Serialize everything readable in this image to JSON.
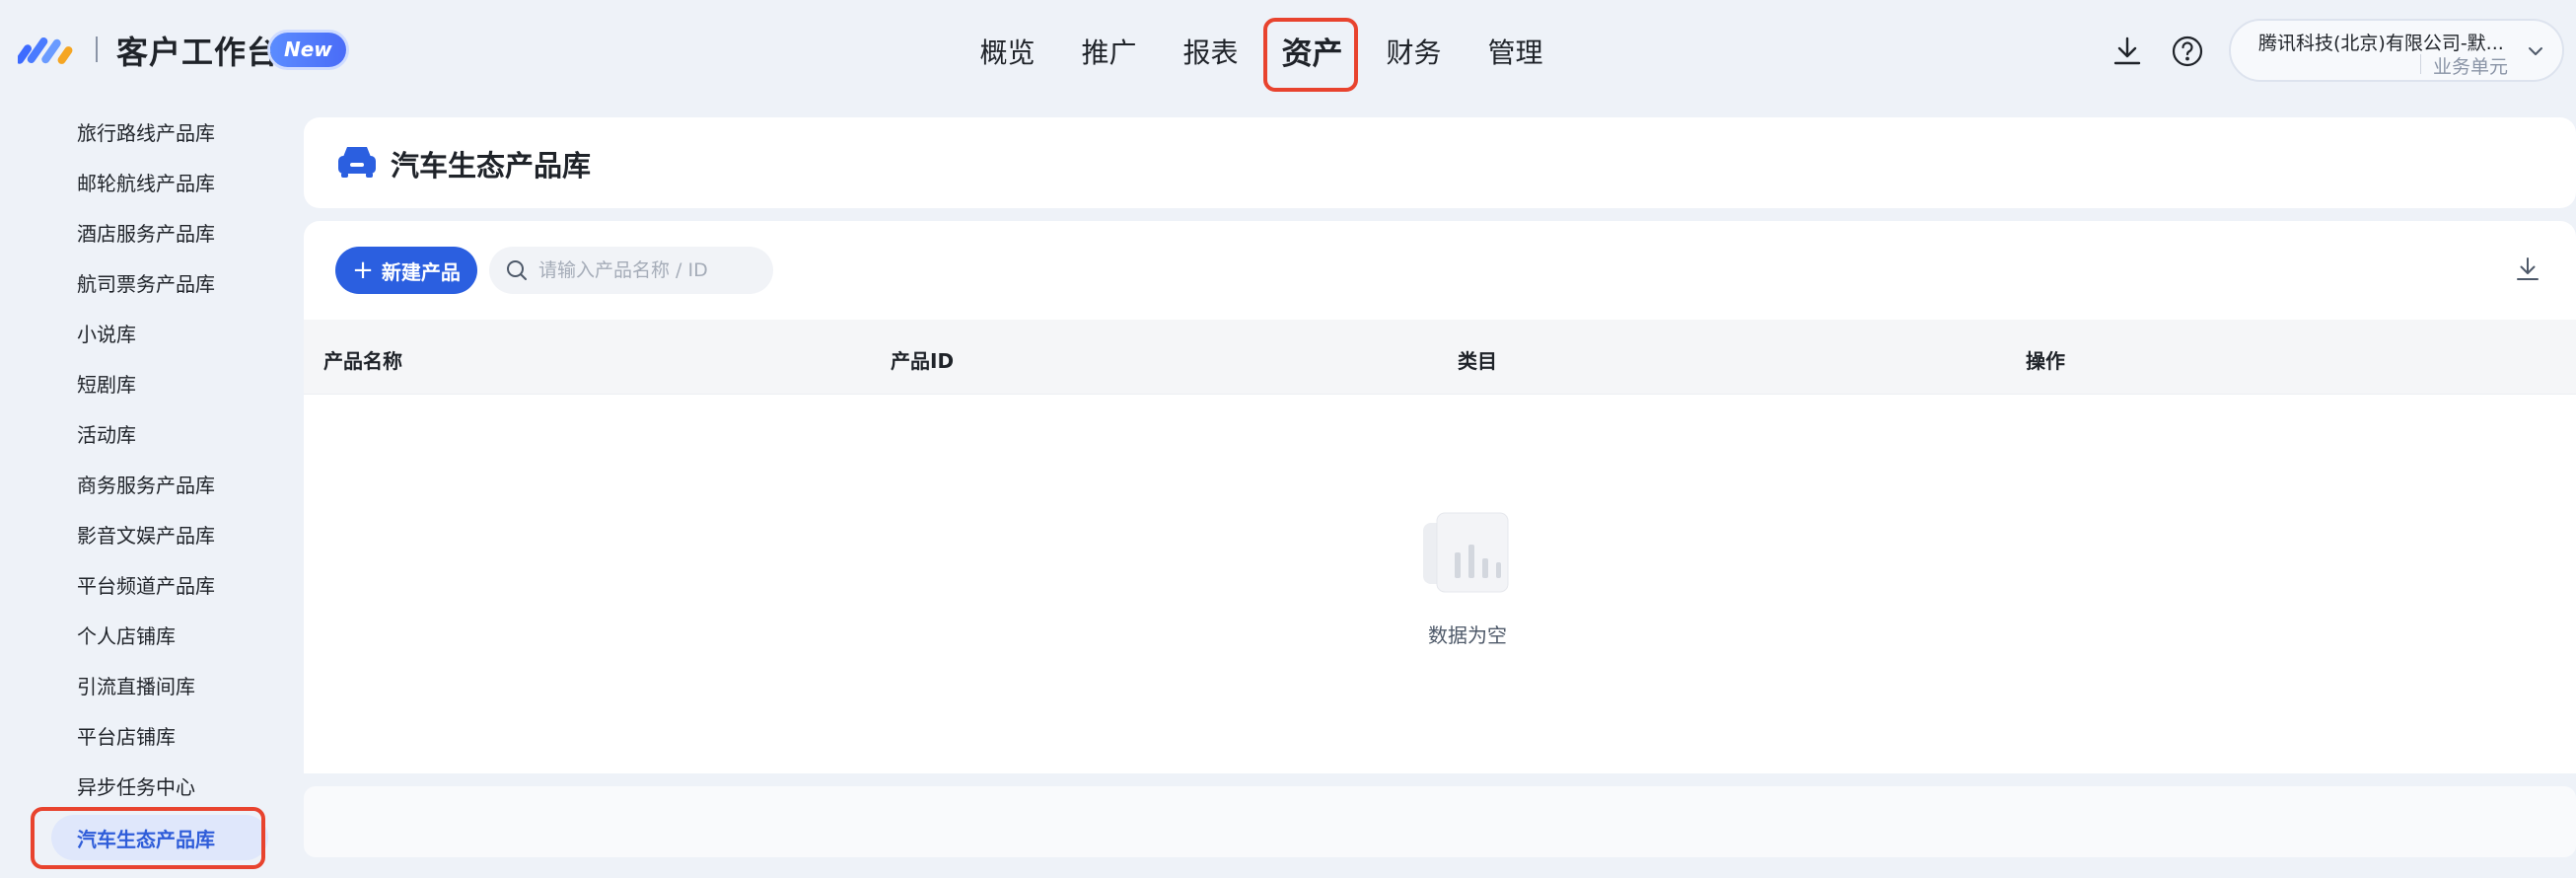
{
  "header": {
    "app_title": "客户工作台",
    "new_badge": "New",
    "nav": [
      "概览",
      "推广",
      "报表",
      "资产",
      "财务",
      "管理"
    ],
    "active_nav": "资产",
    "account_name": "腾讯科技(北京)有限公司-默...",
    "account_sub": "业务单元"
  },
  "sidebar": {
    "items": [
      "旅行路线产品库",
      "邮轮航线产品库",
      "酒店服务产品库",
      "航司票务产品库",
      "小说库",
      "短剧库",
      "活动库",
      "商务服务产品库",
      "影音文娱产品库",
      "平台频道产品库",
      "个人店铺库",
      "引流直播间库",
      "平台店铺库",
      "异步任务中心",
      "汽车生态产品库"
    ],
    "active": "汽车生态产品库"
  },
  "main": {
    "page_title": "汽车生态产品库",
    "new_button": "新建产品",
    "search_placeholder": "请输入产品名称 / ID",
    "columns": [
      "产品名称",
      "产品ID",
      "类目",
      "操作"
    ],
    "empty_text": "数据为空"
  },
  "colors": {
    "primary": "#2b5fe0",
    "highlight_border": "#e8432e",
    "active_bg": "#dfe7fb"
  }
}
